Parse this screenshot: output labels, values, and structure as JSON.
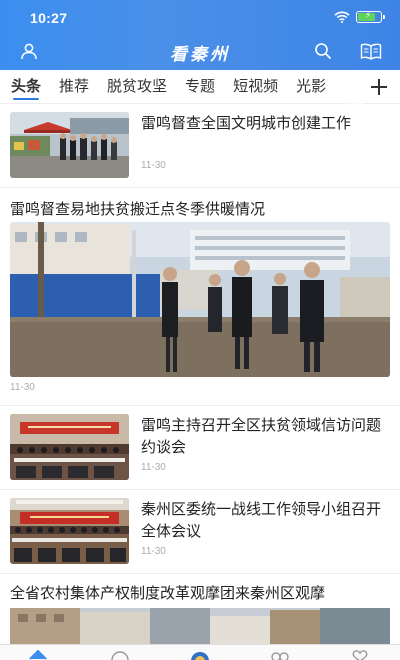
{
  "status_bar": {
    "time": "10:27"
  },
  "header": {
    "title": "看秦州"
  },
  "tabs": [
    {
      "label": "头条",
      "active": true
    },
    {
      "label": "推荐"
    },
    {
      "label": "脱贫攻坚"
    },
    {
      "label": "专题"
    },
    {
      "label": "短视频"
    },
    {
      "label": "光影"
    }
  ],
  "feed": {
    "item1": {
      "title": "雷鸣督查全国文明城市创建工作",
      "date": "11-30"
    },
    "item2": {
      "title": "雷鸣督查易地扶贫搬迁点冬季供暖情况",
      "date": "11-30"
    },
    "item3": {
      "title": "雷鸣主持召开全区扶贫领域信访问题约谈会",
      "date": "11-30"
    },
    "item4": {
      "title": "秦州区委统一战线工作领导小组召开全体会议",
      "date": "11-30"
    },
    "item5": {
      "title": "全省农村集体产权制度改革观摩团来秦州区观摩"
    }
  },
  "colors": {
    "header": "#3b8ef0",
    "accent": "#2d7de0"
  },
  "icons": [
    "user-icon",
    "search-icon",
    "book-icon",
    "wifi-icon",
    "battery-icon",
    "add-icon"
  ]
}
